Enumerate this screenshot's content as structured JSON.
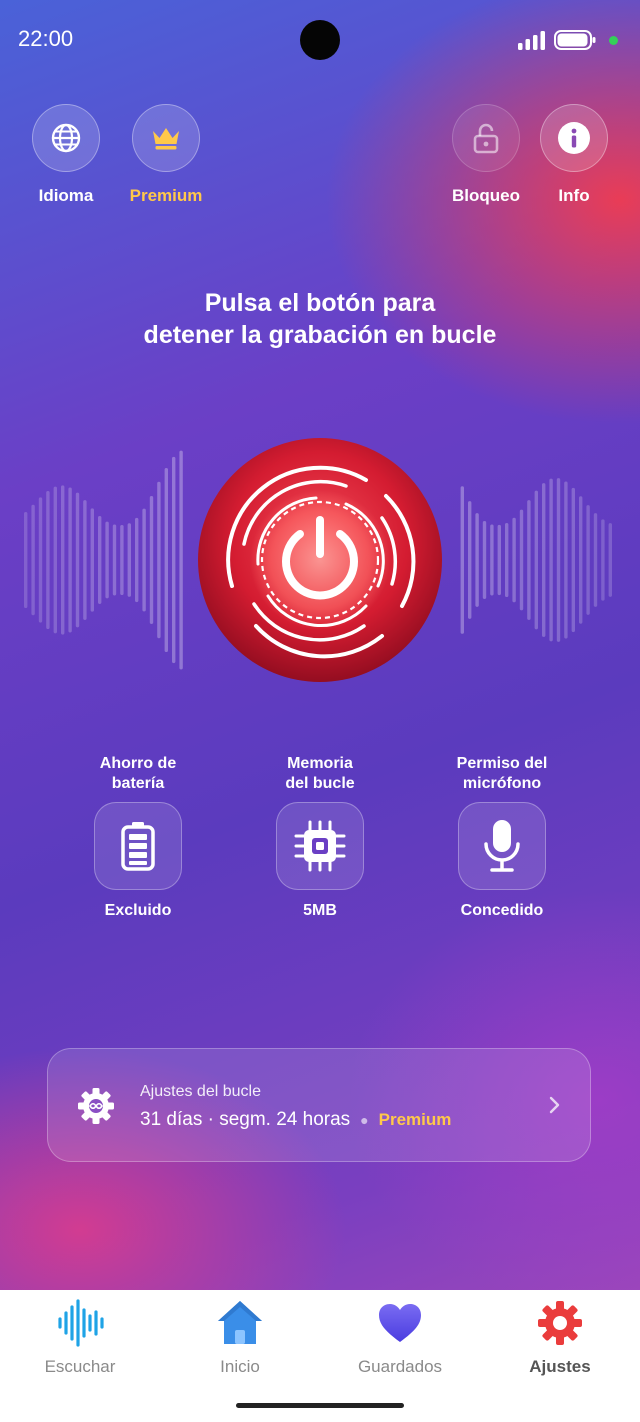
{
  "status_bar": {
    "time": "22:00",
    "battery_level": 0.85,
    "signal_bars": 4,
    "dot_color": "#34d058"
  },
  "top_actions": [
    {
      "label": "Idioma",
      "icon": "globe-icon"
    },
    {
      "label": "Premium",
      "icon": "crown-icon",
      "accent": "#ffc84a"
    },
    {
      "label": "Bloqueo",
      "icon": "lock-icon"
    },
    {
      "label": "Info",
      "icon": "info-icon"
    }
  ],
  "headline": {
    "line1": "Pulsa el botón para",
    "line2": "detener la grabación en bucle"
  },
  "power_button": {
    "icon": "power-icon",
    "color": "#d81f33"
  },
  "features": [
    {
      "title1": "Ahorro de",
      "title2": "batería",
      "value": "Excluido",
      "icon": "battery-icon"
    },
    {
      "title1": "Memoria",
      "title2": "del bucle",
      "value": "5MB",
      "icon": "chip-icon"
    },
    {
      "title1": "Permiso del",
      "title2": "micrófono",
      "value": "Concedido",
      "icon": "microphone-icon"
    }
  ],
  "loop_settings": {
    "title": "Ajustes del bucle",
    "subtitle": "31 días · segm. 24 horas",
    "badge": "Premium",
    "icon": "gear-icon"
  },
  "bottom_nav": [
    {
      "label": "Escuchar",
      "icon": "soundwave-icon",
      "color": "#1fa3e6"
    },
    {
      "label": "Inicio",
      "icon": "home-icon",
      "color": "#3a8ee8"
    },
    {
      "label": "Guardados",
      "icon": "heart-icon",
      "color": "#5a52e8"
    },
    {
      "label": "Ajustes",
      "icon": "gear-icon",
      "color": "#ea3c3c",
      "active": true
    }
  ]
}
